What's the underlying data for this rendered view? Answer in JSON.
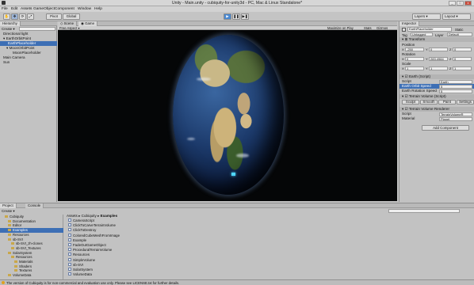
{
  "window": {
    "title": "Unity - Main.unity - cubiquity-for-unity3d - PC, Mac & Linux Standalone*"
  },
  "menus": [
    "File",
    "Edit",
    "Assets",
    "GameObject",
    "Component",
    "Window",
    "Help"
  ],
  "toolbar": {
    "pivot": "Pivot",
    "global": "Global",
    "layers": "Layers",
    "layout": "Layout"
  },
  "hierarchy": {
    "tab": "Hierarchy",
    "create": "Create",
    "items": [
      "Directional light",
      "EarthOrbitPoint",
      "EarthPlaceholder",
      "MoonOrbitPoint",
      "MoonPlaceholder",
      "Main Camera",
      "Sun"
    ],
    "selected_index": 2
  },
  "scene": {
    "tabs": [
      "Scene",
      "Game"
    ],
    "aspect": "Free Aspect",
    "right_labels": [
      "Maximize on Play",
      "Stats",
      "Gizmos"
    ]
  },
  "inspector": {
    "tab": "Inspector",
    "object_name": "EarthPlaceholder",
    "static_label": "Static",
    "tag_label": "Tag",
    "tag_value": "Untagged",
    "layer_label": "Layer",
    "layer_value": "Default",
    "transform": {
      "title": "Transform",
      "position_label": "Position",
      "position": {
        "x": "-250",
        "y": "0",
        "z": "0"
      },
      "rotation_label": "Rotation",
      "rotation": {
        "x": "0",
        "y": "283.4984",
        "z": "0"
      },
      "scale_label": "Scale",
      "scale": {
        "x": "1",
        "y": "1",
        "z": "1"
      }
    },
    "earth": {
      "title": "Earth (Script)",
      "script_label": "Script",
      "script_value": "Earth",
      "orbit_label": "Earth Orbit Speed",
      "orbit_value": "5",
      "rotation_label": "Earth Rotation Speed",
      "rotation_value": "5"
    },
    "terrain": {
      "title": "Terrain Volume (Script)",
      "buttons": [
        "Sculpt",
        "Smooth",
        "Paint",
        "Settings"
      ]
    },
    "renderer": {
      "title": "Terrain Volume Renderer",
      "script_label": "Script",
      "script_value": "TerrainVolumeR",
      "material_label": "Material",
      "material_value": "Planet"
    },
    "add_component": "Add Component"
  },
  "project": {
    "tabs": [
      "Project",
      "Console"
    ],
    "create": "Create",
    "breadcrumb": [
      "Assets",
      "Cubiquity",
      "Examples"
    ],
    "tree": [
      {
        "label": "Cubiquity",
        "indent": 1
      },
      {
        "label": "Documentation",
        "indent": 2
      },
      {
        "label": "Editor",
        "indent": 2
      },
      {
        "label": "Examples",
        "indent": 2,
        "selected": true
      },
      {
        "label": "Resources",
        "indent": 2
      },
      {
        "label": "sb-SVI",
        "indent": 2
      },
      {
        "label": "sb-SVI_zh-clones",
        "indent": 3
      },
      {
        "label": "sb-SVI_Textures",
        "indent": 3
      },
      {
        "label": "SolarSystem",
        "indent": 2
      },
      {
        "label": "Resources",
        "indent": 3
      },
      {
        "label": "Materials",
        "indent": 4
      },
      {
        "label": "Shaders",
        "indent": 4
      },
      {
        "label": "Textures",
        "indent": 4
      },
      {
        "label": "VolumeData",
        "indent": 2
      }
    ],
    "files": [
      "CameraScript",
      "ClickToCarveTerrainVolume",
      "ClickToDestroy",
      "ColoredCubeMeshFromImage",
      "Example",
      "FadeOutGameObject",
      "ProceduralTerrainVolume",
      "Resources",
      "SimpleVolume",
      "sb-SVI",
      "SolarSystem",
      "VolumeData"
    ]
  },
  "status": {
    "text": "The version of Cubiquity is for non-commercial and evaluation use only. Please see LICENSE.txt for further details."
  },
  "colors": {
    "selection": "#3d6fb5",
    "scene_background": "#050607",
    "play_button": "#4a88d0"
  }
}
